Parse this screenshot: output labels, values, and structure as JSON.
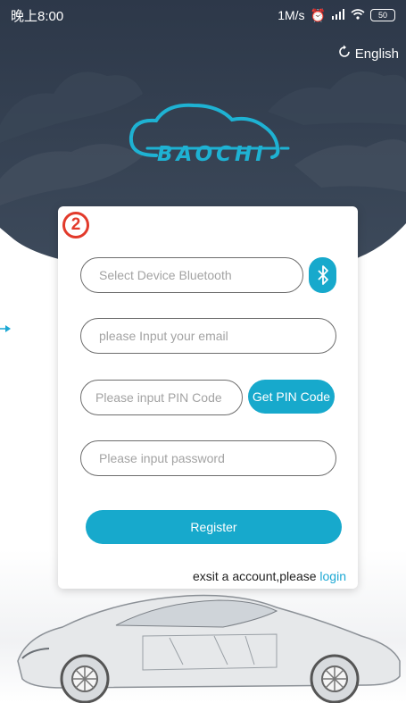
{
  "status_bar": {
    "time": "晚上8:00",
    "network_speed": "1M/s",
    "icons": [
      "alarm-icon",
      "signal-icon",
      "wifi-icon"
    ],
    "battery": "50"
  },
  "language_switch": {
    "label": "English",
    "icon": "refresh-icon"
  },
  "logo": {
    "text": "BAOCHI"
  },
  "form": {
    "step_number": "2",
    "device_placeholder": "Select Device Bluetooth",
    "email_placeholder": "please Input your email",
    "pin_placeholder": "Please input PIN Code",
    "pin_button": "Get PIN Code",
    "password_placeholder": "Please input password",
    "register_button": "Register",
    "login_prompt": "exsit a account,please ",
    "login_link": "login"
  },
  "colors": {
    "accent": "#17a9cc",
    "header_dark": "#2b3646",
    "step_red": "#e23a2b"
  }
}
